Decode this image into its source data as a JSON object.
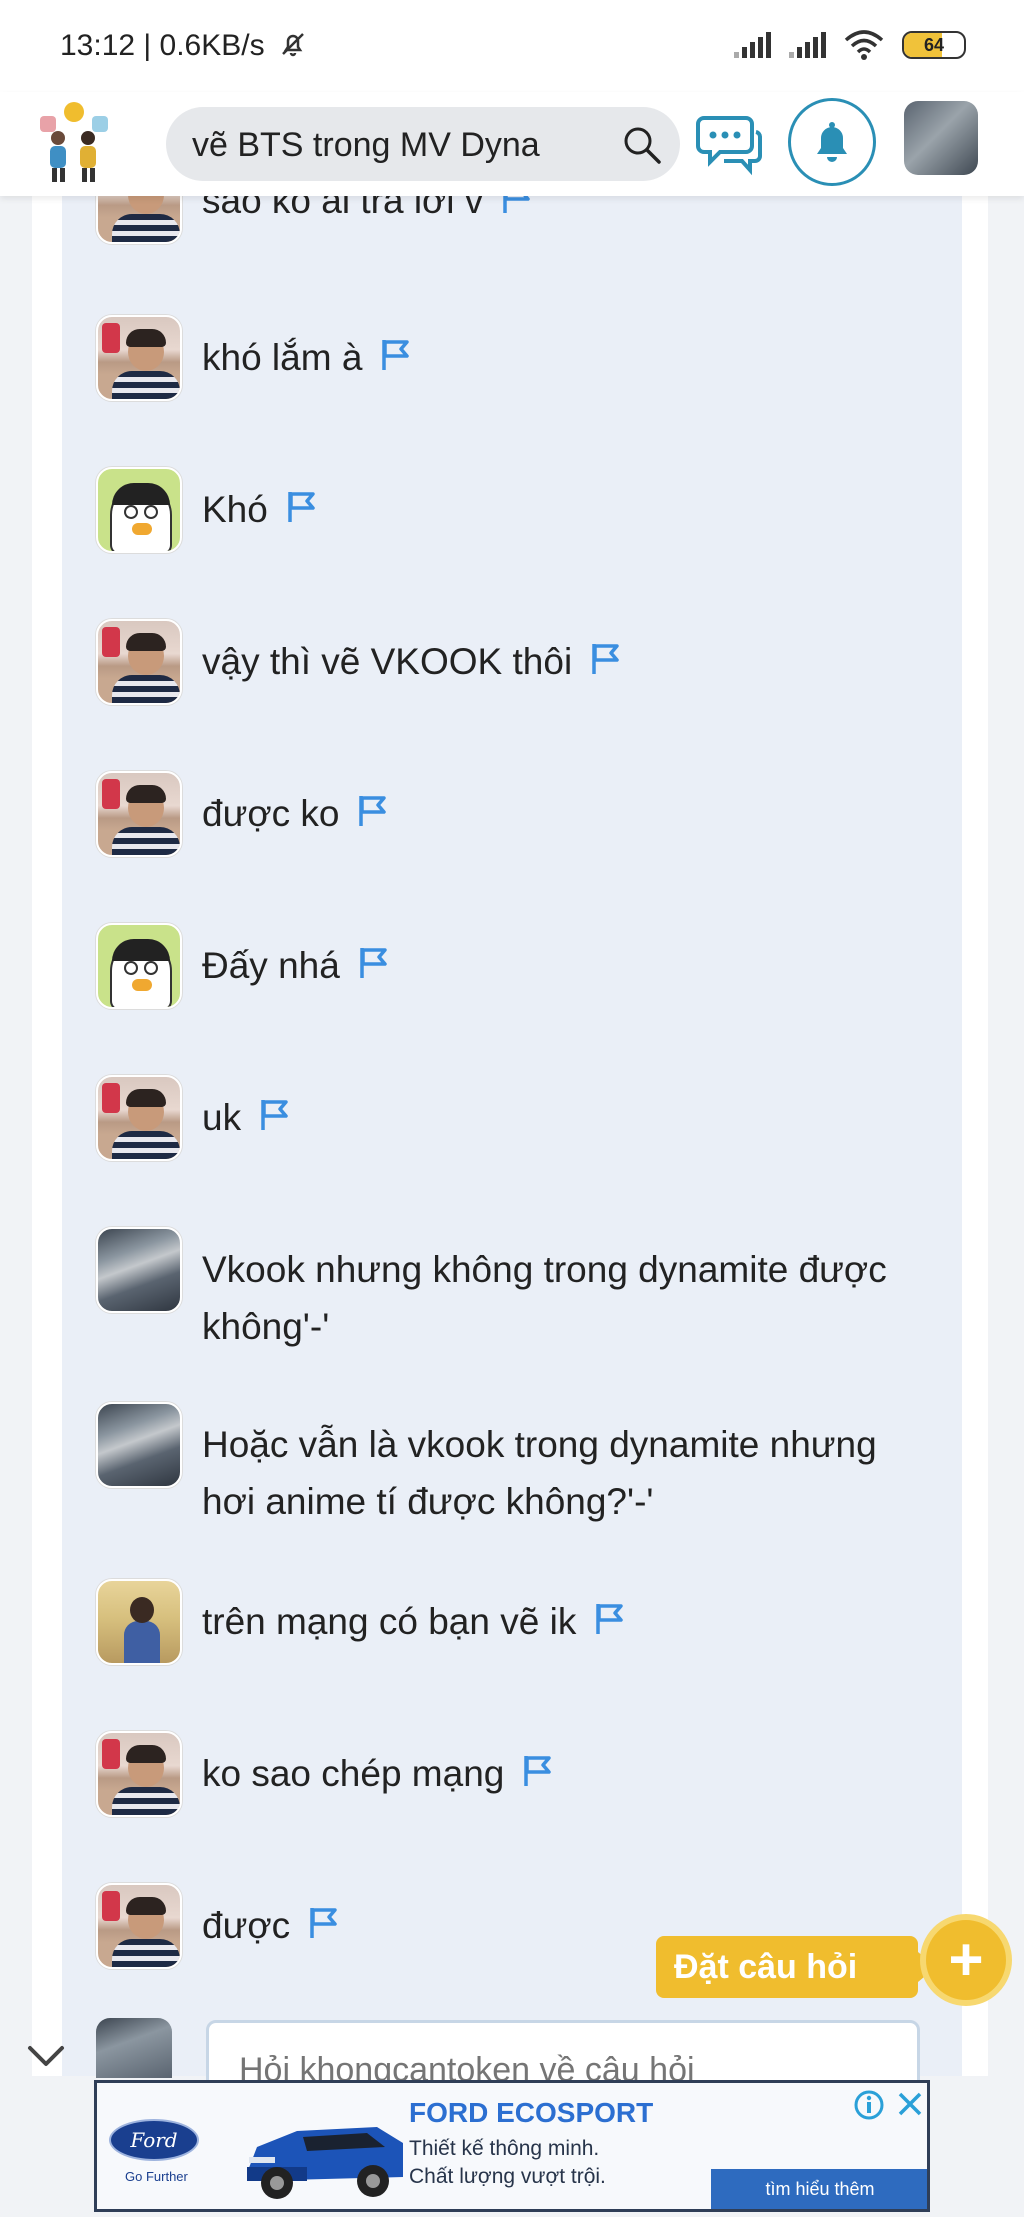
{
  "status_bar": {
    "time_speed": "13:12 | 0.6KB/s",
    "battery": "64"
  },
  "header": {
    "search_query": "vẽ BTS trong MV Dyna",
    "icons": [
      "logo-icon",
      "search-icon",
      "chat-bubbles-icon",
      "bell-icon",
      "user-avatar"
    ]
  },
  "messages": [
    {
      "avatar": "boy",
      "text": "sao ko ai trả lời v",
      "flag": true
    },
    {
      "avatar": "boy",
      "text": "khó lắm à",
      "flag": true
    },
    {
      "avatar": "duck",
      "text": "Khó",
      "flag": true
    },
    {
      "avatar": "boy",
      "text": "vậy thì vẽ VKOOK thôi",
      "flag": true
    },
    {
      "avatar": "boy",
      "text": "được ko",
      "flag": true
    },
    {
      "avatar": "duck",
      "text": "Đấy nhá",
      "flag": true
    },
    {
      "avatar": "boy",
      "text": "uk",
      "flag": true
    },
    {
      "avatar": "city",
      "text": "Vkook nhưng không trong dynamite được không'-'",
      "flag": false
    },
    {
      "avatar": "city",
      "text": "Hoặc vẫn là vkook trong dynamite nhưng hơi anime tí được không?'-'",
      "flag": false
    },
    {
      "avatar": "girl",
      "text": "trên mạng có bạn vẽ ik",
      "flag": true
    },
    {
      "avatar": "boy",
      "text": "ko sao chép mạng",
      "flag": true
    },
    {
      "avatar": "boy",
      "text": "được",
      "flag": true
    }
  ],
  "reply": {
    "placeholder": "Hỏi khongcantoken về câu hỏi"
  },
  "ask_button": {
    "label": "Đặt câu hỏi",
    "plus": "+"
  },
  "ad": {
    "brand": "Ford",
    "brand_tagline": "Go Further",
    "title": "FORD ECOSPORT",
    "line1": "Thiết kế thông minh.",
    "line2": "Chất lượng vượt trội.",
    "cta": "tìm hiểu thêm"
  },
  "colors": {
    "accent_blue": "#2a8fb5",
    "flag_blue": "#3a8ee0",
    "ask_yellow": "#f0bd2e",
    "panel_bg": "#eaeff7"
  }
}
